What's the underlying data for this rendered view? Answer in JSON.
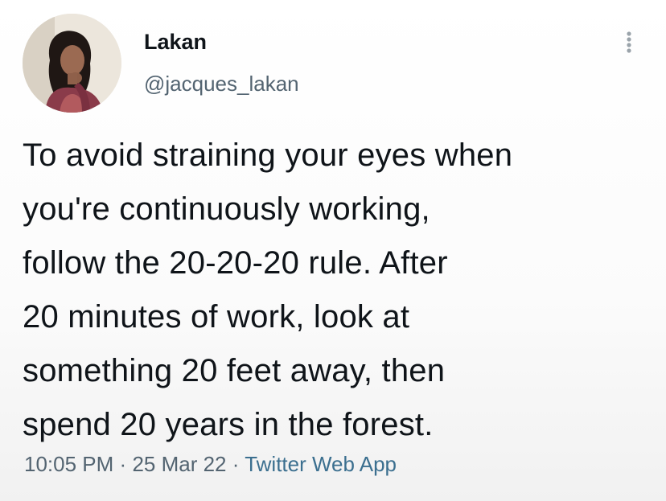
{
  "tweet": {
    "author": {
      "display_name": "Lakan",
      "handle": "@jacques_lakan"
    },
    "more_icon": "more-vertical-dots-icon",
    "text_lines": [
      "To avoid straining your eyes when",
      "you're continuously working,",
      "follow the 20-20-20 rule. After",
      "20 minutes of work, look at",
      "something 20 feet away, then",
      "spend 20 years in the forest."
    ],
    "meta": {
      "time": "10:05 PM",
      "separator": "·",
      "date": "25 Mar 22",
      "source": "Twitter Web App"
    }
  },
  "colors": {
    "text": "#0f1419",
    "secondary": "#536471",
    "source_link": "#3b6f8f"
  }
}
